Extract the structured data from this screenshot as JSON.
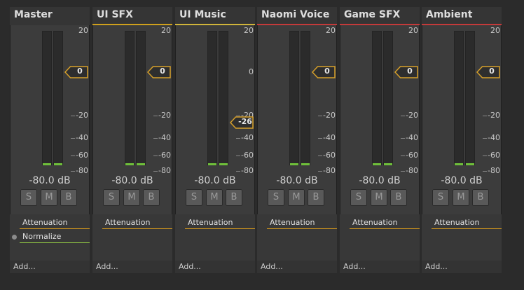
{
  "colors": {
    "background": "#2b2b2b",
    "strip": "#3c3c3c",
    "level_fill": "#6fbf3a",
    "fader_outline": "#d7a02a",
    "effect_attenuation": "#d79a1c",
    "effect_normalize": "#8fc444"
  },
  "db_scale": [
    "20",
    "0",
    "-20",
    "-40",
    "-60",
    "-80"
  ],
  "strips": [
    {
      "title": "Master",
      "header_color": "#353535",
      "fader_value": "0",
      "fader_db": 0,
      "volume": "-80.0 dB",
      "buttons": [
        "S",
        "M",
        "B"
      ],
      "effects": [
        {
          "label": "Attenuation",
          "color": "#d79a1c",
          "active_dot": false
        },
        {
          "label": "Normalize",
          "color": "#8fc444",
          "active_dot": true
        }
      ],
      "add_label": "Add..."
    },
    {
      "title": "UI SFX",
      "header_color": "#cfa01c",
      "fader_value": "0",
      "fader_db": 0,
      "volume": "-80.0 dB",
      "buttons": [
        "S",
        "M",
        "B"
      ],
      "effects": [
        {
          "label": "Attenuation",
          "color": "#d79a1c",
          "active_dot": false
        }
      ],
      "add_label": "Add..."
    },
    {
      "title": "UI Music",
      "header_color": "#d0b43a",
      "fader_value": "-26",
      "fader_db": -26,
      "volume": "-80.0 dB",
      "buttons": [
        "S",
        "M",
        "B"
      ],
      "effects": [
        {
          "label": "Attenuation",
          "color": "#d79a1c",
          "active_dot": false
        }
      ],
      "add_label": "Add..."
    },
    {
      "title": "Naomi Voice",
      "header_color": "#c43a3a",
      "fader_value": "0",
      "fader_db": 0,
      "volume": "-80.0 dB",
      "buttons": [
        "S",
        "M",
        "B"
      ],
      "effects": [
        {
          "label": "Attenuation",
          "color": "#d79a1c",
          "active_dot": false
        }
      ],
      "add_label": "Add..."
    },
    {
      "title": "Game SFX",
      "header_color": "#c43a3a",
      "fader_value": "0",
      "fader_db": 0,
      "volume": "-80.0 dB",
      "buttons": [
        "S",
        "M",
        "B"
      ],
      "effects": [
        {
          "label": "Attenuation",
          "color": "#d79a1c",
          "active_dot": false
        }
      ],
      "add_label": "Add..."
    },
    {
      "title": "Ambient",
      "header_color": "#c43a3a",
      "fader_value": "0",
      "fader_db": 0,
      "volume": "-80.0 dB",
      "buttons": [
        "S",
        "M",
        "B"
      ],
      "effects": [
        {
          "label": "Attenuation",
          "color": "#d79a1c",
          "active_dot": false
        }
      ],
      "add_label": "Add..."
    }
  ]
}
